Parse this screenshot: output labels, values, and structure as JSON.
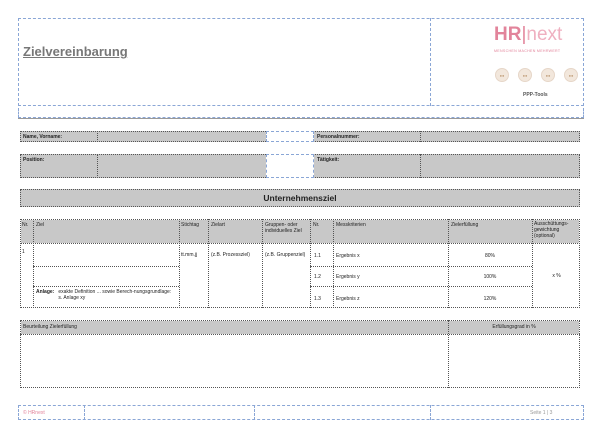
{
  "header": {
    "title": "Zielvereinbarung",
    "logo_left": "HR",
    "logo_right": "next",
    "tagline": "MENSCHEN MACHEN MEHRWERT",
    "tools_label": "PPP-Tools",
    "icons": [
      "ppp-icon-1",
      "ppp-icon-2",
      "ppp-icon-3",
      "ppp-icon-4"
    ]
  },
  "personal": {
    "name_label": "Name, Vorname:",
    "personalnummer_label": "Personalnummer:",
    "position_label": "Position:",
    "taetigkeit_label": "Tätigkeit:"
  },
  "section": {
    "title": "Unternehmensziel"
  },
  "table": {
    "col_nr": "Nr.",
    "col_ziel": "Ziel",
    "col_stichtag": "Stichtag",
    "col_zielart": "Zielart",
    "col_gruppen": "Gruppen- oder individuelles Ziel",
    "col_nr2": "Nr.",
    "col_messkriterien": "Messkriterien",
    "col_zielerfuellung": "Zielerfüllung",
    "col_ausschuettung": "Ausschüttungs-gewichtung (optional)",
    "row_nr": "1",
    "stichtag": "tt.mm.jj",
    "zielart": "(z.B. Prozessziel)",
    "gruppen": "(z.B. Gruppenziel)",
    "anlage_label": "Anlage:",
    "anlage_text": "exakte Definition ... sowie Berech-nungsgrundlage: s. Anlage xy",
    "weighting": "x %",
    "criteria": [
      {
        "nr": "1.1",
        "name": "Ergebnis x",
        "value": "80%"
      },
      {
        "nr": "1.2",
        "name": "Ergebnis y",
        "value": "100%"
      },
      {
        "nr": "1.3",
        "name": "Ergebnis z",
        "value": "120%"
      }
    ]
  },
  "assessment": {
    "label": "Beurteilung Zielerfüllung",
    "degree_label": "Erfüllungsgrad in %"
  },
  "footer": {
    "copyright": "© HRnext",
    "page": "Seite 1 | 3"
  },
  "colors": {
    "brand": "#e2849b",
    "brand_light": "#efb0c0",
    "frame": "#8aa6d6",
    "header_gray": "#c8c8c8"
  }
}
